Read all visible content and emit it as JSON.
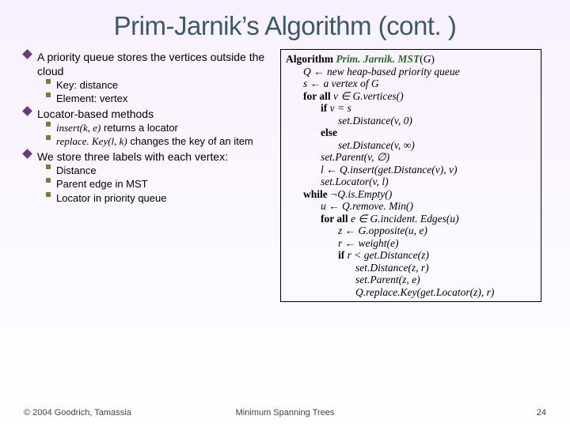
{
  "title": "Prim-Jarnik’s Algorithm (cont. )",
  "left": {
    "b1": "A priority queue stores the vertices outside the cloud",
    "b1a": "Key: distance",
    "b1b": "Element: vertex",
    "b2": "Locator-based methods",
    "b2a_i": "insert",
    "b2a_p": "(k, e)",
    "b2a_t": " returns a locator",
    "b2b_i": "replace. Key",
    "b2b_p": "(l, k)",
    "b2b_t": " changes the key of an item",
    "b3": "We store three labels with each vertex:",
    "b3a": "Distance",
    "b3b": "Parent edge in MST",
    "b3c": "Locator in priority queue"
  },
  "algo": {
    "l0a": "Algorithm ",
    "l0b": "Prim. Jarnik. MST",
    "l0c": "(",
    "l0d": "G",
    "l0e": ")",
    "l1": "Q ← new heap-based priority queue",
    "l2": "s ← a vertex of G",
    "l3a": "for all ",
    "l3b": "v ∈ G.vertices()",
    "l4a": "if ",
    "l4b": "v = s",
    "l5": "set.Distance(v, 0)",
    "l6": "else",
    "l7": "set.Distance(v, ∞)",
    "l8": "set.Parent(v, ∅)",
    "l9": "l ← Q.insert(get.Distance(v), v)",
    "l10": "set.Locator(v, l)",
    "l11a": "while ",
    "l11b": "¬Q.is.Empty()",
    "l12": "u ← Q.remove. Min()",
    "l13a": "for all ",
    "l13b": "e ∈ G.incident. Edges(u)",
    "l14": "z ← G.opposite(u, e)",
    "l15": "r ← weight(e)",
    "l16a": "if ",
    "l16b": "r < get.Distance(z)",
    "l17": "set.Distance(z, r)",
    "l18": "set.Parent(z, e)",
    "l19": "Q.replace.Key(get.Locator(z), r)"
  },
  "footer": {
    "copyright": "© 2004 Goodrich, Tamassia",
    "mid": "Minimum Spanning Trees",
    "page": "24"
  }
}
